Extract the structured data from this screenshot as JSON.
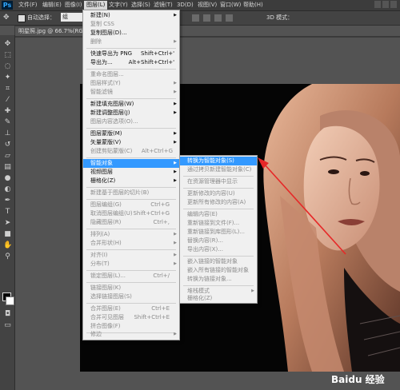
{
  "app": {
    "logo": "Ps"
  },
  "menubar": {
    "items": [
      {
        "label": "文件(F)"
      },
      {
        "label": "编辑(E)"
      },
      {
        "label": "图像(I)"
      },
      {
        "label": "图层(L)",
        "active": true
      },
      {
        "label": "文字(Y)"
      },
      {
        "label": "选择(S)"
      },
      {
        "label": "滤镜(T)"
      },
      {
        "label": "3D(D)"
      },
      {
        "label": "视图(V)"
      },
      {
        "label": "窗口(W)"
      },
      {
        "label": "帮助(H)"
      }
    ]
  },
  "options_bar": {
    "auto_select_label": "自动选择：",
    "auto_select_value": "组",
    "right_label": "3D 模式："
  },
  "document": {
    "tab_title": "明星照.jpg @ 66.7%(RGB/8#)"
  },
  "layer_menu": {
    "items": [
      {
        "label": "新建(N)",
        "shortcut": "",
        "submenu": true,
        "disabled": false
      },
      {
        "label": "复制 CSS",
        "shortcut": "",
        "submenu": false,
        "disabled": true
      },
      {
        "label": "复制图层(D)...",
        "shortcut": "",
        "submenu": false,
        "disabled": false
      },
      {
        "label": "删除",
        "shortcut": "",
        "submenu": true,
        "disabled": true
      },
      {
        "label": "快速导出为 PNG",
        "shortcut": "Shift+Ctrl+'",
        "submenu": false,
        "disabled": false
      },
      {
        "label": "导出为...",
        "shortcut": "Alt+Shift+Ctrl+'",
        "submenu": false,
        "disabled": false
      },
      {
        "label": "重命名图层...",
        "shortcut": "",
        "submenu": false,
        "disabled": true
      },
      {
        "label": "图层样式(Y)",
        "shortcut": "",
        "submenu": true,
        "disabled": true
      },
      {
        "label": "智能滤镜",
        "shortcut": "",
        "submenu": true,
        "disabled": true
      },
      {
        "label": "新建填充图层(W)",
        "shortcut": "",
        "submenu": true,
        "disabled": false
      },
      {
        "label": "新建调整图层(J)",
        "shortcut": "",
        "submenu": true,
        "disabled": false
      },
      {
        "label": "图层内容选项(O)...",
        "shortcut": "",
        "submenu": false,
        "disabled": true
      },
      {
        "label": "图层蒙版(M)",
        "shortcut": "",
        "submenu": true,
        "disabled": false
      },
      {
        "label": "矢量蒙版(V)",
        "shortcut": "",
        "submenu": true,
        "disabled": false
      },
      {
        "label": "创建剪贴蒙版(C)",
        "shortcut": "Alt+Ctrl+G",
        "submenu": false,
        "disabled": true
      },
      {
        "label": "智能对象",
        "shortcut": "",
        "submenu": true,
        "disabled": false,
        "highlighted": true
      },
      {
        "label": "视频图层",
        "shortcut": "",
        "submenu": true,
        "disabled": false
      },
      {
        "label": "栅格化(Z)",
        "shortcut": "",
        "submenu": true,
        "disabled": false
      },
      {
        "label": "新建基于图层的切片(B)",
        "shortcut": "",
        "submenu": false,
        "disabled": true
      },
      {
        "label": "图层编组(G)",
        "shortcut": "Ctrl+G",
        "submenu": false,
        "disabled": true
      },
      {
        "label": "取消图层编组(U)",
        "shortcut": "Shift+Ctrl+G",
        "submenu": false,
        "disabled": true
      },
      {
        "label": "隐藏图层(R)",
        "shortcut": "Ctrl+,",
        "submenu": false,
        "disabled": true
      },
      {
        "label": "排列(A)",
        "shortcut": "",
        "submenu": true,
        "disabled": true
      },
      {
        "label": "合并形状(H)",
        "shortcut": "",
        "submenu": true,
        "disabled": true
      },
      {
        "label": "对齐(I)",
        "shortcut": "",
        "submenu": true,
        "disabled": true
      },
      {
        "label": "分布(T)",
        "shortcut": "",
        "submenu": true,
        "disabled": true
      },
      {
        "label": "锁定图层(L)...",
        "shortcut": "Ctrl+/",
        "submenu": false,
        "disabled": true
      },
      {
        "label": "链接图层(K)",
        "shortcut": "",
        "submenu": false,
        "disabled": true
      },
      {
        "label": "选择链接图层(S)",
        "shortcut": "",
        "submenu": false,
        "disabled": true
      },
      {
        "label": "合并图层(E)",
        "shortcut": "Ctrl+E",
        "submenu": false,
        "disabled": true
      },
      {
        "label": "合并可见图层",
        "shortcut": "Shift+Ctrl+E",
        "submenu": false,
        "disabled": true
      },
      {
        "label": "拼合图像(F)",
        "shortcut": "",
        "submenu": false,
        "disabled": true
      },
      {
        "label": "修边",
        "shortcut": "",
        "submenu": true,
        "disabled": true
      }
    ]
  },
  "smart_object_menu": {
    "items": [
      {
        "label": "转换为智能对象(S)",
        "disabled": false,
        "highlighted": true
      },
      {
        "label": "通过拷贝新建智能对象(C)",
        "disabled": true
      },
      {
        "label": "在资源管理器中显示",
        "disabled": true
      },
      {
        "label": "更新修改的内容(U)",
        "disabled": true
      },
      {
        "label": "更新所有修改的内容(A)",
        "disabled": true
      },
      {
        "label": "编辑内容(E)",
        "disabled": true
      },
      {
        "label": "重新链接到文件(F)...",
        "disabled": true
      },
      {
        "label": "重新链接到库图形(L)...",
        "disabled": true
      },
      {
        "label": "替换内容(R)...",
        "disabled": true
      },
      {
        "label": "导出内容(X)...",
        "disabled": true
      },
      {
        "label": "嵌入链接的智能对象",
        "disabled": true
      },
      {
        "label": "嵌入所有链接的智能对象",
        "disabled": true
      },
      {
        "label": "转换为链接对象...",
        "disabled": true
      },
      {
        "label": "堆栈模式",
        "disabled": true,
        "submenu": true
      },
      {
        "label": "栅格化(Z)",
        "disabled": true
      }
    ]
  },
  "watermark": {
    "text": "Baidu 经验"
  }
}
